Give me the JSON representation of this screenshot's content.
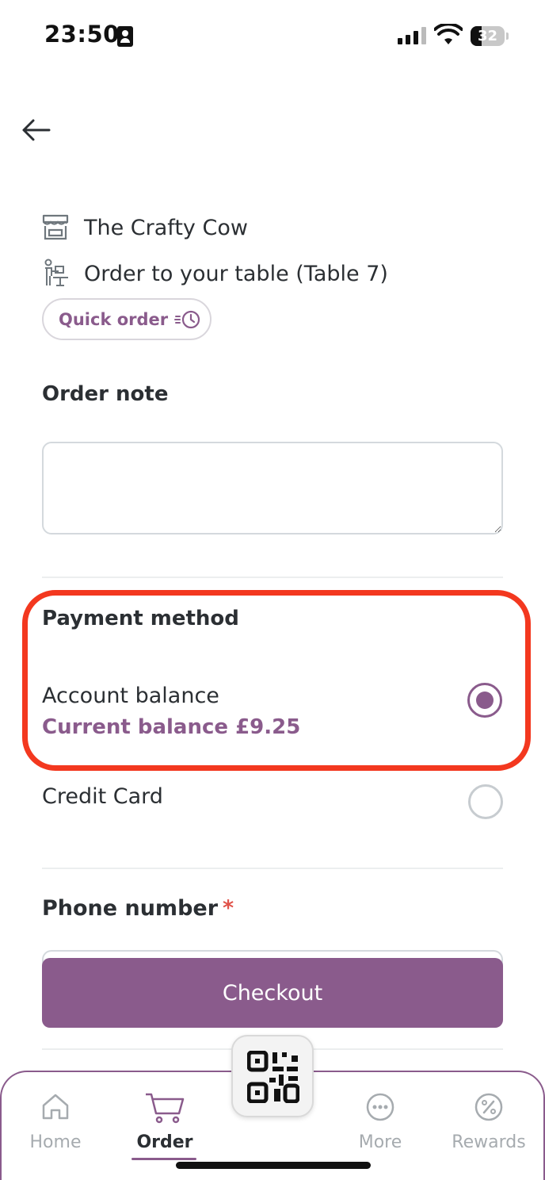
{
  "status_bar": {
    "time": "23:50",
    "battery": "32"
  },
  "venue": {
    "name": "The Crafty Cow",
    "service": "Order to your table (Table 7)",
    "quick_order_label": "Quick order"
  },
  "order_note": {
    "title": "Order note",
    "value": "",
    "placeholder": ""
  },
  "payment": {
    "title": "Payment method",
    "options": [
      {
        "label": "Account balance",
        "sublabel": "Current balance £9.25",
        "selected": true
      },
      {
        "label": "Credit Card",
        "selected": false
      }
    ]
  },
  "phone": {
    "title": "Phone number",
    "required_mark": "*"
  },
  "checkout_label": "Checkout",
  "tabs": [
    {
      "label": "Home",
      "icon": "home-icon",
      "active": false
    },
    {
      "label": "Order",
      "icon": "cart-icon",
      "active": true
    },
    {
      "label": "More",
      "icon": "more-icon",
      "active": false
    },
    {
      "label": "Rewards",
      "icon": "percent-icon",
      "active": false
    }
  ],
  "colors": {
    "accent": "#8a5b8c",
    "highlight": "#f3381f",
    "text": "#2b2f33"
  }
}
